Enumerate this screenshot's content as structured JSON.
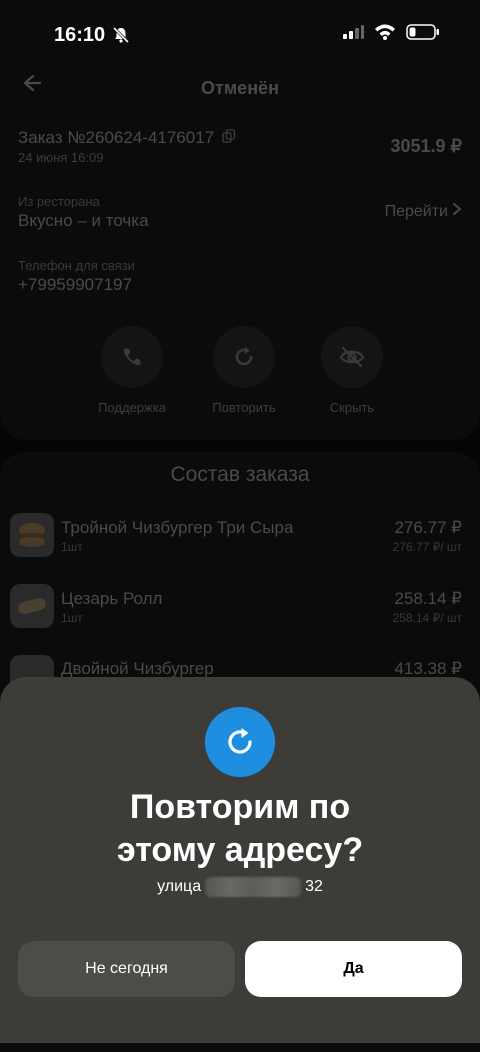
{
  "status_bar": {
    "time": "16:10"
  },
  "header": {
    "title": "Отменён"
  },
  "order": {
    "number": "Заказ №260624-4176017",
    "date": "24 июня 16:09",
    "total": "3051.9 ₽",
    "restaurant_label": "Из ресторана",
    "restaurant_name": "Вкусно – и точка",
    "goto_label": "Перейти",
    "phone_label": "Телефон для связи",
    "phone": "+79959907197"
  },
  "actions": [
    {
      "label": "Поддержка",
      "icon": "support-chat-icon"
    },
    {
      "label": "Повторить",
      "icon": "repeat-icon"
    },
    {
      "label": "Скрыть",
      "icon": "hide-eye-icon"
    }
  ],
  "composition": {
    "title": "Состав заказа",
    "items": [
      {
        "name": "Тройной Чизбургер Три Сыра",
        "qty": "1шт",
        "price": "276.77 ₽",
        "unit_price": "276.77 ₽/ шт"
      },
      {
        "name": "Цезарь Ролл",
        "qty": "1шт",
        "price": "258.14 ₽",
        "unit_price": "258.14 ₽/ шт"
      },
      {
        "name": "Двойной Чизбургер",
        "qty": "",
        "price": "413.38 ₽",
        "unit_price": ""
      }
    ]
  },
  "sheet": {
    "title_line1": "Повторим по",
    "title_line2": "этому адресу?",
    "address_prefix": "улица",
    "address_suffix": "32",
    "no_button": "Не сегодня",
    "yes_button": "Да",
    "icon_color": "#1e8fe0"
  }
}
